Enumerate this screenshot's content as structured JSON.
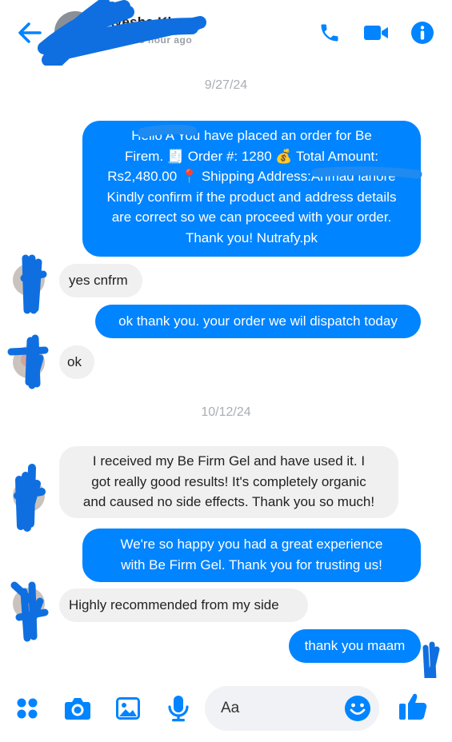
{
  "header": {
    "contact_name": "Ayesha Khan",
    "status": "Active 3 hour ago",
    "icons": [
      "back-arrow-icon",
      "phone-icon",
      "video-camera-icon",
      "info-icon"
    ],
    "accent_color": "#0084ff"
  },
  "dates": [
    "9/27/24",
    "10/12/24"
  ],
  "messages": {
    "m1": {
      "lines": [
        "Hello A          You have placed an order for Be",
        "Firem. 🧾 Order #: 1280 💰 Total Amount:",
        "Rs2,480.00 📍 Shipping Address:Ahmad lahore",
        "Kindly confirm if the product and address details",
        "are correct so we can proceed with your order.",
        "Thank you! Nutrafy.pk"
      ]
    },
    "m2": {
      "text": "yes cnfrm"
    },
    "m3": {
      "text": "ok thank you. your order we wil dispatch today"
    },
    "m4": {
      "text": "ok"
    },
    "m5": {
      "lines": [
        "I received my Be Firm Gel and have used it. I",
        "got really good results! It's completely organic",
        "and caused no side effects. Thank you so much!"
      ]
    },
    "m6": {
      "lines": [
        "We're so happy you had a great experience",
        "with Be Firm Gel. Thank you for trusting us!"
      ]
    },
    "m7": {
      "text": "Highly recommended from my side"
    },
    "m8": {
      "text": "thank you maam"
    }
  },
  "composer": {
    "placeholder": "Aa",
    "icons": [
      "apps-icon",
      "camera-icon",
      "gallery-icon",
      "microphone-icon",
      "emoji-icon",
      "like-icon"
    ]
  },
  "colors": {
    "outgoing": "#0084ff",
    "incoming": "#f0f0f0",
    "date": "#a9aeb5"
  }
}
